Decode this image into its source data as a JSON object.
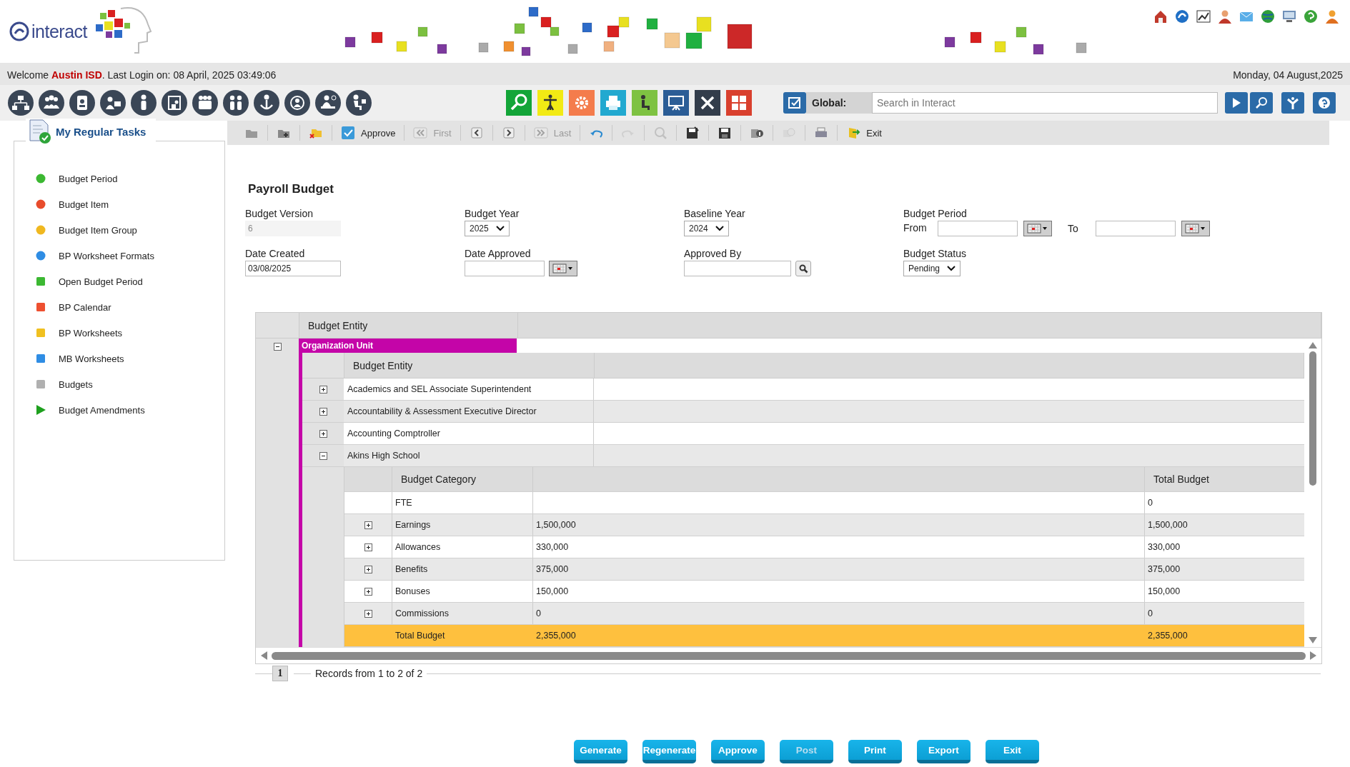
{
  "header": {
    "logo": "interact",
    "welcome": "Welcome **Austin ISD**. Last Login on: 08 April, 2025 03:49:06",
    "date": "Monday, 04 August,2025"
  },
  "global_search": {
    "label": "Global:",
    "placeholder": "Search in Interact"
  },
  "toolbar": {
    "items": [
      {
        "disabled": false
      },
      {
        "disabled": false
      },
      {
        "disabled": false
      },
      {
        "label": "Approve",
        "disabled": false
      },
      {
        "label": "First",
        "disabled": true
      },
      {
        "disabled": false
      },
      {
        "disabled": false
      },
      {
        "label": "Last",
        "disabled": true
      },
      {
        "disabled": false
      },
      {
        "disabled": true
      },
      {
        "disabled": true
      },
      {
        "disabled": false
      },
      {
        "disabled": false
      },
      {
        "disabled": false
      },
      {
        "disabled": true
      },
      {
        "disabled": false
      },
      {
        "label": "Exit",
        "disabled": false
      }
    ]
  },
  "sidebar": {
    "title": "My Regular Tasks",
    "items": [
      {
        "label": "Budget Period",
        "kind": "dot",
        "color": "#3cb832"
      },
      {
        "label": "Budget Item",
        "kind": "dot",
        "color": "#e84c2c"
      },
      {
        "label": "Budget Item Group",
        "kind": "dot",
        "color": "#f0b820"
      },
      {
        "label": "BP Worksheet Formats",
        "kind": "dot",
        "color": "#2f8de4"
      },
      {
        "label": "Open Budget Period",
        "kind": "square",
        "color": "#3cb832"
      },
      {
        "label": "BP Calendar",
        "kind": "square",
        "color": "#ee5030"
      },
      {
        "label": "BP Worksheets",
        "kind": "square",
        "color": "#f0c020"
      },
      {
        "label": "MB Worksheets",
        "kind": "square",
        "color": "#2f8de4"
      },
      {
        "label": "Budgets",
        "kind": "square",
        "color": "#b0b0b0"
      },
      {
        "label": "Budget Amendments",
        "kind": "triangle",
        "color": "#1ea01e"
      }
    ]
  },
  "form": {
    "title": "Payroll Budget",
    "fields": [
      {
        "label": "Budget Version",
        "kind": "text",
        "value": "6",
        "disabled": true
      },
      {
        "label": "Budget Year",
        "kind": "select",
        "value": "2025"
      },
      {
        "label": "Baseline Year",
        "kind": "select",
        "value": "2024"
      },
      {
        "label": "Budget Period",
        "kind": "range",
        "from_label": "From",
        "to_label": "To"
      },
      {
        "label": "Date Created",
        "kind": "text",
        "value": "03/08/2025",
        "disabled": false
      },
      {
        "label": "Date Approved",
        "kind": "date"
      },
      {
        "label": "Approved By",
        "kind": "lookup"
      },
      {
        "label": "Budget Status",
        "kind": "select",
        "value": "Pending"
      }
    ]
  },
  "grid": {
    "header": "Budget Entity",
    "group": {
      "label": "Organization Unit",
      "expanded": true
    },
    "inner_header": "Budget Entity",
    "entities": [
      {
        "name": "Academics and SEL Associate Superintendent",
        "expanded": false
      },
      {
        "name": "Accountability & Assessment Executive Director",
        "expanded": false
      },
      {
        "name": "Accounting Comptroller",
        "expanded": false
      },
      {
        "name": "Akins High School",
        "expanded": true,
        "categories": {
          "columns": [
            "Budget Category",
            "Total Budget"
          ],
          "rows": [
            {
              "kind": "category",
              "expandable": false,
              "category": "FTE",
              "total_budget": "0"
            },
            {
              "kind": "category",
              "expandable": true,
              "category": "Earnings",
              "column_2": "1,500,000",
              "total_budget": "1,500,000"
            },
            {
              "kind": "category",
              "expandable": true,
              "category": "Allowances",
              "column_2": "330,000",
              "total_budget": "330,000"
            },
            {
              "kind": "category",
              "expandable": true,
              "category": "Benefits",
              "column_2": "375,000",
              "total_budget": "375,000"
            },
            {
              "kind": "category",
              "expandable": true,
              "category": "Bonuses",
              "column_2": "150,000",
              "total_budget": "150,000"
            },
            {
              "kind": "category",
              "expandable": true,
              "category": "Commissions",
              "column_2": "0",
              "total_budget": "0"
            },
            {
              "kind": "total",
              "expandable": false,
              "category": "Total Budget",
              "column_2": "2,355,000",
              "total_budget": "2,355,000"
            }
          ]
        }
      }
    ],
    "pager": {
      "page": "1",
      "records": "Records from 1 to 2 of 2"
    }
  },
  "buttons": [
    {
      "label": "Generate",
      "disabled": false
    },
    {
      "label": "Regenerate",
      "disabled": false
    },
    {
      "label": "Approve",
      "disabled": false
    },
    {
      "label": "Post",
      "disabled": true
    },
    {
      "label": "Print",
      "disabled": false
    },
    {
      "label": "Export",
      "disabled": false
    },
    {
      "label": "Exit",
      "disabled": false
    }
  ]
}
